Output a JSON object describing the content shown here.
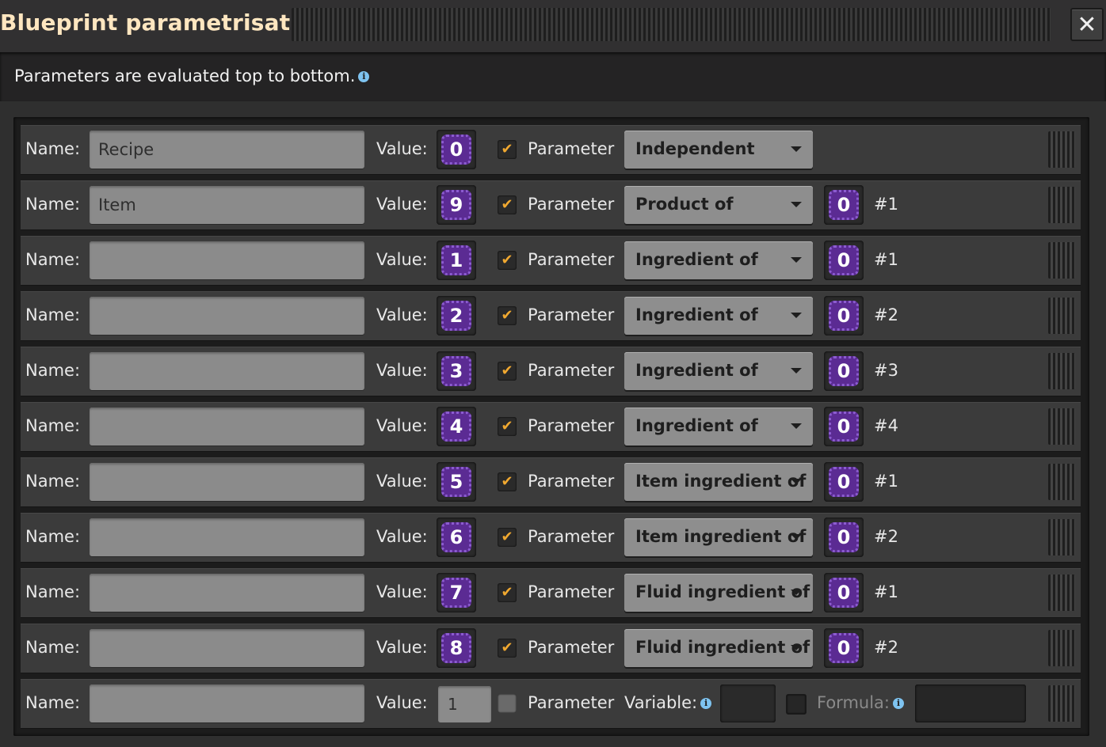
{
  "window": {
    "title": "Blueprint parametrisation",
    "close_icon": "close-icon"
  },
  "info": {
    "text": "Parameters are evaluated top to bottom.",
    "icon": "info-icon"
  },
  "labels": {
    "name": "Name:",
    "value": "Value:",
    "parameter": "Parameter",
    "variable": "Variable:",
    "formula": "Formula:"
  },
  "colors": {
    "title": "#ffe6c0",
    "signal": "#5b2b93",
    "checkbox_check": "#f0a830",
    "info_icon": "#7ec3f0"
  },
  "rows": [
    {
      "name": "Recipe",
      "value": "0",
      "parameter": true,
      "mode": "Independent",
      "source": "",
      "index": ""
    },
    {
      "name": "Item",
      "value": "9",
      "parameter": true,
      "mode": "Product of",
      "source": "0",
      "index": "#1"
    },
    {
      "name": "",
      "value": "1",
      "parameter": true,
      "mode": "Ingredient of",
      "source": "0",
      "index": "#1"
    },
    {
      "name": "",
      "value": "2",
      "parameter": true,
      "mode": "Ingredient of",
      "source": "0",
      "index": "#2"
    },
    {
      "name": "",
      "value": "3",
      "parameter": true,
      "mode": "Ingredient of",
      "source": "0",
      "index": "#3"
    },
    {
      "name": "",
      "value": "4",
      "parameter": true,
      "mode": "Ingredient of",
      "source": "0",
      "index": "#4"
    },
    {
      "name": "",
      "value": "5",
      "parameter": true,
      "mode": "Item ingredient of",
      "source": "0",
      "index": "#1"
    },
    {
      "name": "",
      "value": "6",
      "parameter": true,
      "mode": "Item ingredient of",
      "source": "0",
      "index": "#2"
    },
    {
      "name": "",
      "value": "7",
      "parameter": true,
      "mode": "Fluid ingredient of",
      "source": "0",
      "index": "#1"
    },
    {
      "name": "",
      "value": "8",
      "parameter": true,
      "mode": "Fluid ingredient of",
      "source": "0",
      "index": "#2"
    }
  ],
  "number_row": {
    "name": "",
    "value": "1",
    "parameter": false,
    "variable": "",
    "formula_enabled": false,
    "formula": ""
  }
}
